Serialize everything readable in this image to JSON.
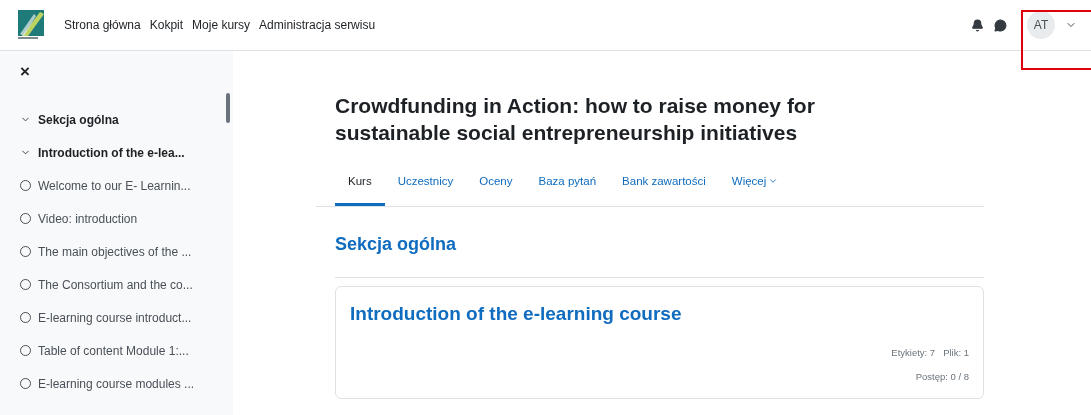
{
  "navbar": {
    "links": [
      "Strona główna",
      "Kokpit",
      "Moje kursy",
      "Administracja serwisu"
    ],
    "avatar": "AT",
    "highlighted": true
  },
  "sidebar": {
    "close": "×",
    "sections": [
      {
        "title": "Sekcja ogólna",
        "expanded": true
      },
      {
        "title": "Introduction of the e-lea...",
        "expanded": true,
        "children": [
          {
            "title": "Welcome to our E- Learnin..."
          },
          {
            "title": "Video: introduction"
          },
          {
            "title": "The main objectives of the ..."
          },
          {
            "title": "The Consortium and the co..."
          },
          {
            "title": "E-learning course introduct..."
          },
          {
            "title": "Table of content Module 1:..."
          },
          {
            "title": "E-learning course modules ..."
          }
        ]
      }
    ]
  },
  "course": {
    "title": "Crowdfunding in Action: how to raise money for sustainable social entrepreneurship initiatives",
    "tabs": [
      {
        "label": "Kurs",
        "selected": true,
        "kind": "link"
      },
      {
        "label": "Uczestnicy",
        "selected": false,
        "kind": "link"
      },
      {
        "label": "Oceny",
        "selected": false,
        "kind": "link"
      },
      {
        "label": "Baza pytań",
        "selected": false,
        "kind": "link"
      },
      {
        "label": "Bank zawartości",
        "selected": false,
        "kind": "link"
      },
      {
        "label": "Więcej",
        "selected": false,
        "kind": "menu"
      }
    ],
    "section_heading": "Sekcja ogólna",
    "card": {
      "title": "Introduction of the e-learning course",
      "counts": [
        "Etykiety: 7",
        "Plik: 1"
      ],
      "progress": "Postęp: 0 / 8"
    }
  }
}
